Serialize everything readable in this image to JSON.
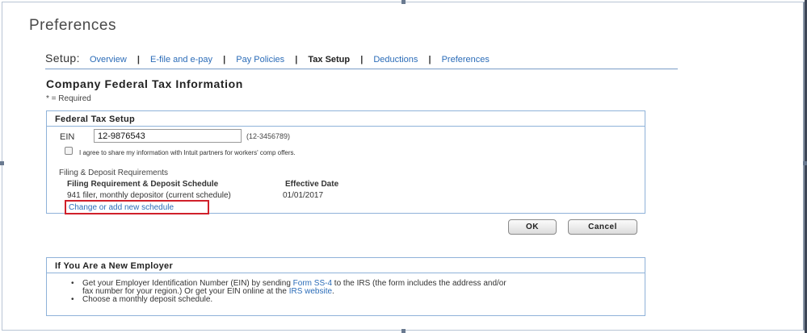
{
  "page_title": "Preferences",
  "setup_nav": {
    "label": "Setup:",
    "tabs": [
      {
        "label": "Overview"
      },
      {
        "label": "E-file and e-pay"
      },
      {
        "label": "Pay Policies"
      },
      {
        "label": "Tax Setup"
      },
      {
        "label": "Deductions"
      },
      {
        "label": "Preferences"
      }
    ],
    "separator": "|"
  },
  "section": {
    "title": "Company Federal Tax Information",
    "required_note": "* = Required"
  },
  "federal_tax_setup": {
    "header": "Federal Tax Setup",
    "ein_label": "EIN",
    "ein_value": "12-9876543",
    "ein_format_hint": "(12-3456789)",
    "share_checkbox_label": "I agree to share my information with Intuit partners for workers' comp offers.",
    "share_checked": false,
    "filing_heading": "Filing & Deposit Requirements",
    "col_schedule": "Filing Requirement & Deposit Schedule",
    "col_effective_date": "Effective Date",
    "schedule_value": "941 filer, monthly depositor (current schedule)",
    "effective_date_value": "01/01/2017",
    "change_link": "Change or add new schedule"
  },
  "buttons": {
    "ok": "OK",
    "cancel": "Cancel"
  },
  "new_employer": {
    "header": "If You Are a New Employer",
    "bullet1_part1": "Get your Employer Identification Number (EIN) by sending ",
    "bullet1_link1": "Form SS-4",
    "bullet1_part2": " to the IRS (the form includes the address and/or",
    "bullet1_line2": "fax number for your region.) Or get your EIN online at the ",
    "bullet1_link2": "IRS website",
    "bullet1_end": ".",
    "bullet2": "Choose a monthly deposit schedule."
  }
}
